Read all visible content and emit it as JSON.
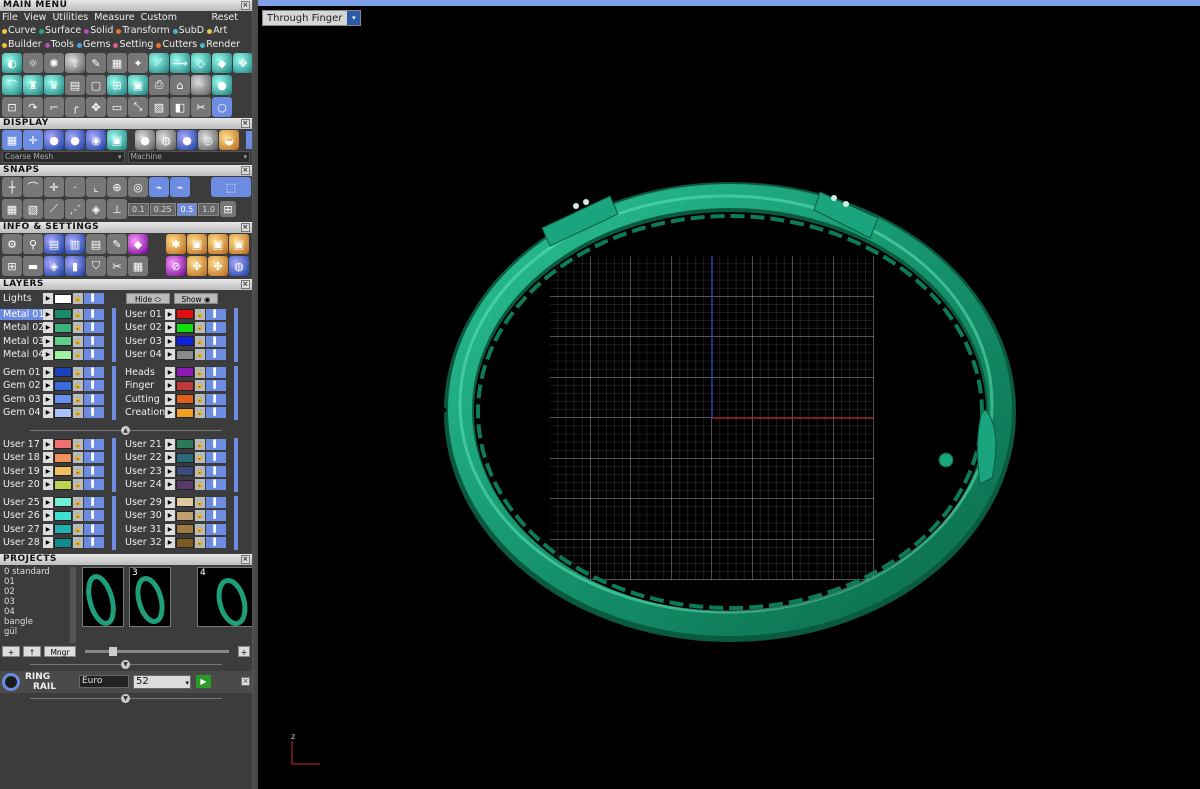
{
  "panel": {
    "main_menu": {
      "title": "MAIN MENU",
      "close": "×",
      "menu": [
        "File",
        "View",
        "Utilities",
        "Measure",
        "Custom"
      ],
      "reset": "Reset",
      "row1": [
        {
          "label": "Curve",
          "color": "#f0c23a"
        },
        {
          "label": "Surface",
          "color": "#2aa58c"
        },
        {
          "label": "Solid",
          "color": "#b24fb6"
        },
        {
          "label": "Transform",
          "color": "#e5762f"
        },
        {
          "label": "SubD",
          "color": "#49b6d6"
        },
        {
          "label": "Art",
          "color": "#e3c24a"
        }
      ],
      "row2": [
        {
          "label": "Builder",
          "color": "#f0c23a"
        },
        {
          "label": "Tools",
          "color": "#b24fb6"
        },
        {
          "label": "Gems",
          "color": "#4aa3e0"
        },
        {
          "label": "Setting",
          "color": "#e0608a"
        },
        {
          "label": "Cutters",
          "color": "#e5762f"
        },
        {
          "label": "Render",
          "color": "#49b6d6"
        }
      ]
    },
    "display": {
      "title": "DISPLAY",
      "close": "×",
      "mesh": "Coarse Mesh",
      "material": "Machine"
    },
    "snaps": {
      "title": "SNAPS",
      "close": "×",
      "values": [
        "0.1",
        "0.25",
        "0.5",
        "1.0"
      ]
    },
    "info": {
      "title": "INFO & SETTINGS",
      "close": "×"
    },
    "layers": {
      "title": "LAYERS",
      "close": "×",
      "lights": "Lights",
      "hide": "Hide",
      "show": "Show",
      "groups": [
        {
          "left": [
            {
              "name": "Metal 01",
              "color": "#1a8a6a",
              "sel": true
            },
            {
              "name": "Metal 02",
              "color": "#3bb37a"
            },
            {
              "name": "Metal 03",
              "color": "#5fd08a"
            },
            {
              "name": "Metal 04",
              "color": "#9ef2a0"
            }
          ],
          "right": [
            {
              "name": "User 01",
              "color": "#e01010"
            },
            {
              "name": "User 02",
              "color": "#10e010"
            },
            {
              "name": "User 03",
              "color": "#1020e0"
            },
            {
              "name": "User 04",
              "color": "#8a8a8a"
            }
          ]
        },
        {
          "left": [
            {
              "name": "Gem 01",
              "color": "#1a40c0"
            },
            {
              "name": "Gem 02",
              "color": "#3a6ae0"
            },
            {
              "name": "Gem 03",
              "color": "#6a90f0"
            },
            {
              "name": "Gem 04",
              "color": "#a8c0f8"
            }
          ],
          "right": [
            {
              "name": "Heads",
              "color": "#8a1ab0"
            },
            {
              "name": "Finger",
              "color": "#c03a3a"
            },
            {
              "name": "Cutting",
              "color": "#e0601a"
            },
            {
              "name": "Creation",
              "color": "#f0a020"
            }
          ]
        },
        {
          "left": [
            {
              "name": "User 17",
              "color": "#f07070"
            },
            {
              "name": "User 18",
              "color": "#f0905a"
            },
            {
              "name": "User 19",
              "color": "#f0c060"
            },
            {
              "name": "User 20",
              "color": "#c0d050"
            }
          ],
          "right": [
            {
              "name": "User 21",
              "color": "#2a7a5a"
            },
            {
              "name": "User 22",
              "color": "#2a6a7a"
            },
            {
              "name": "User 23",
              "color": "#3a4a7a"
            },
            {
              "name": "User 24",
              "color": "#5a3a6a"
            }
          ]
        },
        {
          "left": [
            {
              "name": "User 25",
              "color": "#70f0d0"
            },
            {
              "name": "User 26",
              "color": "#40e0d0"
            },
            {
              "name": "User 27",
              "color": "#20b0b0"
            },
            {
              "name": "User 28",
              "color": "#108a8a"
            }
          ],
          "right": [
            {
              "name": "User 29",
              "color": "#e0c8a0"
            },
            {
              "name": "User 30",
              "color": "#c0a070"
            },
            {
              "name": "User 31",
              "color": "#a07a40"
            },
            {
              "name": "User 32",
              "color": "#7a5a20"
            }
          ]
        }
      ]
    },
    "projects": {
      "title": "PROJECTS",
      "close": "×",
      "items": [
        "0 standard",
        "01",
        "02",
        "03",
        "04",
        "bangle",
        "gül"
      ],
      "thumbs": [
        "",
        "3",
        "4"
      ],
      "mngr": "Mngr"
    },
    "ring_rail": {
      "line1": "RING",
      "line2": "RAIL",
      "unit": "Euro",
      "size": "52"
    }
  },
  "viewport": {
    "view_mode": "Through Finger",
    "axis_label": "z"
  }
}
